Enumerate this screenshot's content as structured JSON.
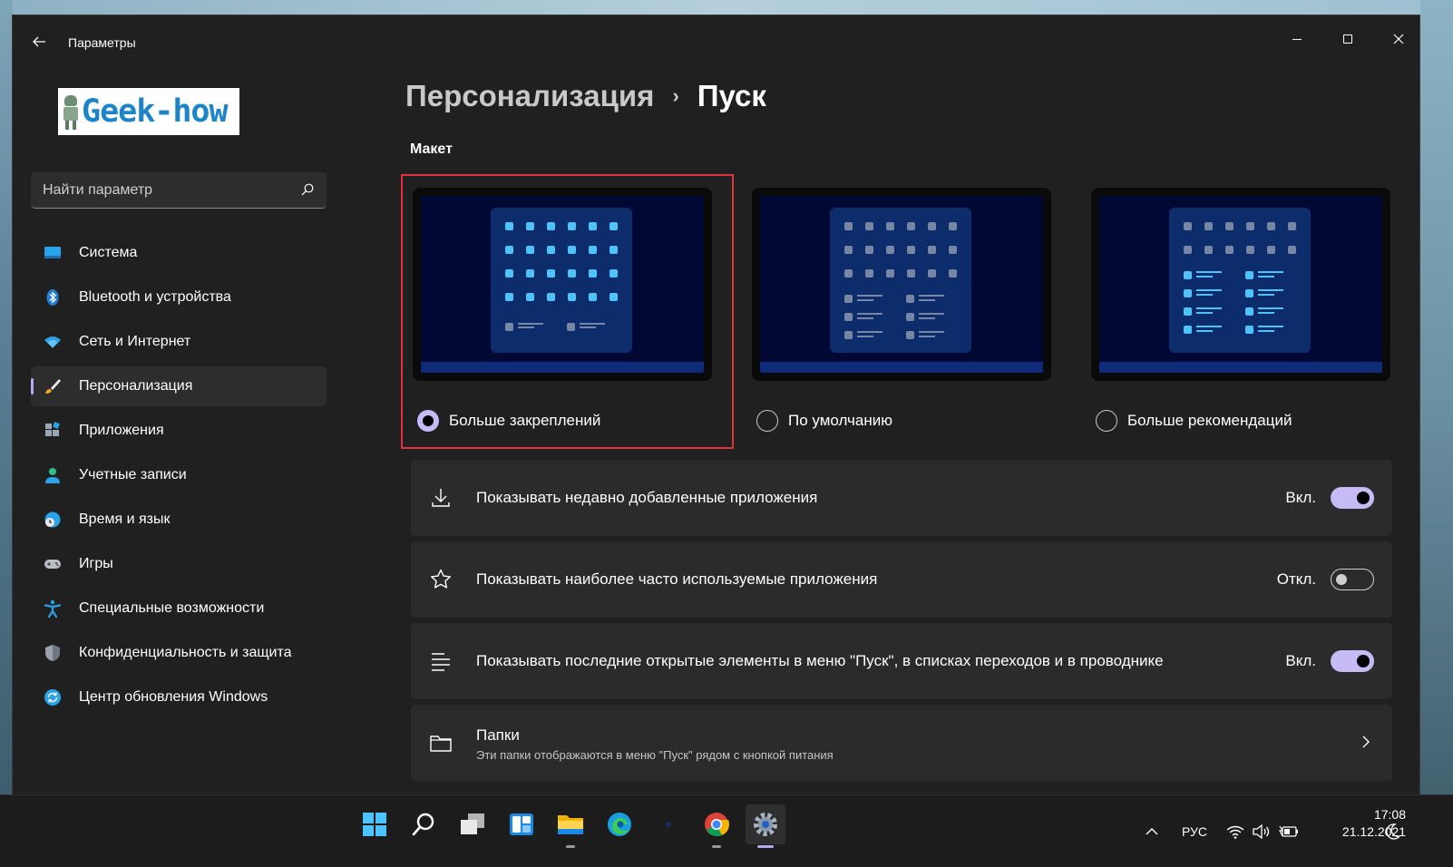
{
  "window": {
    "title": "Параметры"
  },
  "logo": {
    "text": "Geek-how"
  },
  "search": {
    "placeholder": "Найти параметр"
  },
  "sidebar": {
    "items": [
      {
        "label": "Система",
        "icon": "monitor-icon"
      },
      {
        "label": "Bluetooth и устройства",
        "icon": "bluetooth-icon"
      },
      {
        "label": "Сеть и Интернет",
        "icon": "wifi-icon"
      },
      {
        "label": "Персонализация",
        "icon": "brush-icon",
        "active": true
      },
      {
        "label": "Приложения",
        "icon": "apps-icon"
      },
      {
        "label": "Учетные записи",
        "icon": "person-icon"
      },
      {
        "label": "Время и язык",
        "icon": "globe-clock-icon"
      },
      {
        "label": "Игры",
        "icon": "gamepad-icon"
      },
      {
        "label": "Специальные возможности",
        "icon": "accessibility-icon"
      },
      {
        "label": "Конфиденциальность и защита",
        "icon": "shield-icon"
      },
      {
        "label": "Центр обновления Windows",
        "icon": "update-icon"
      }
    ]
  },
  "breadcrumb": {
    "parent": "Персонализация",
    "separator": "›",
    "current": "Пуск"
  },
  "layout": {
    "section_label": "Макет",
    "options": [
      {
        "label": "Больше закреплений",
        "selected": true
      },
      {
        "label": "По умолчанию",
        "selected": false
      },
      {
        "label": "Больше рекомендаций",
        "selected": false
      }
    ]
  },
  "settings": [
    {
      "label": "Показывать недавно добавленные приложения",
      "state": "Вкл.",
      "on": true,
      "icon": "download-icon"
    },
    {
      "label": "Показывать наиболее часто используемые приложения",
      "state": "Откл.",
      "on": false,
      "icon": "star-icon"
    },
    {
      "label": "Показывать последние открытые элементы в меню \"Пуск\", в списках переходов и в проводнике",
      "state": "Вкл.",
      "on": true,
      "icon": "list-icon"
    }
  ],
  "folders": {
    "title": "Папки",
    "subtitle": "Эти папки отображаются в меню \"Пуск\" рядом с кнопкой питания"
  },
  "taskbar": {
    "apps": [
      "start-icon",
      "search-icon",
      "task-view-icon",
      "widgets-icon",
      "file-explorer-icon",
      "edge-icon",
      "app-icon",
      "chrome-icon",
      "settings-icon"
    ],
    "language": "РУС",
    "time": "17:08",
    "date": "21.12.2021"
  },
  "colors": {
    "accent": "#c6bbf4",
    "highlight": "#e2333a",
    "tile_blue": "#4fc3f7"
  }
}
